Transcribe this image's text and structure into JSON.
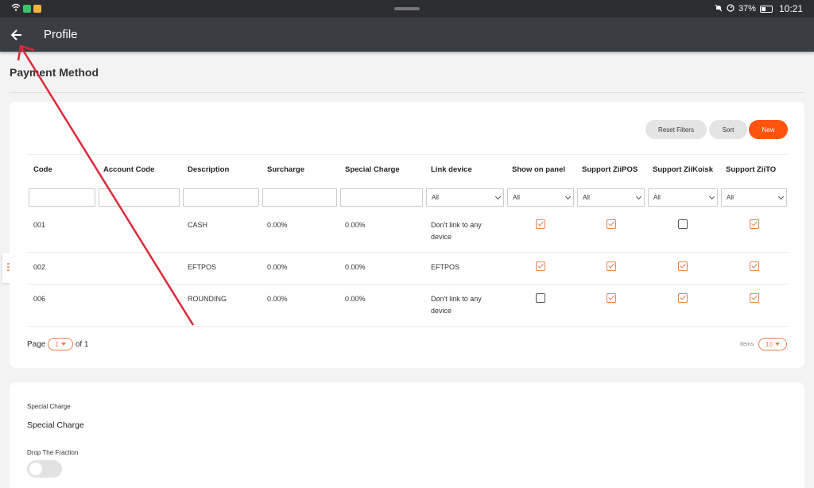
{
  "status_bar": {
    "battery": "37%",
    "time": "10:21"
  },
  "appbar": {
    "title": "Profile"
  },
  "page": {
    "title": "Payment Method"
  },
  "toolbar": {
    "reset_filters": "Reset Filters",
    "sort": "Sort",
    "new": "New"
  },
  "table": {
    "headers": [
      "Code",
      "Account Code",
      "Description",
      "Surcharge",
      "Special Charge",
      "Link device",
      "Show on panel",
      "Support ZiiPOS",
      "Support ZiiKoisk",
      "Support ZiiTO"
    ],
    "filter_select_value": "All",
    "rows": [
      {
        "code": "001",
        "account_code": "",
        "description": "CASH",
        "surcharge": "0.00%",
        "special_charge": "0.00%",
        "link_device": "Don't link to any device",
        "show_on_panel": true,
        "support_ziipos": true,
        "support_ziikoisk": false,
        "support_ziito": true
      },
      {
        "code": "002",
        "account_code": "",
        "description": "EFTPOS",
        "surcharge": "0.00%",
        "special_charge": "0.00%",
        "link_device": "EFTPOS",
        "show_on_panel": true,
        "support_ziipos": true,
        "support_ziikoisk": true,
        "support_ziito": true
      },
      {
        "code": "006",
        "account_code": "",
        "description": "ROUNDING",
        "surcharge": "0.00%",
        "special_charge": "0.00%",
        "link_device": "Don't link to any device",
        "show_on_panel": false,
        "support_ziipos": true,
        "support_ziikoisk": true,
        "support_ziito": true
      }
    ]
  },
  "pagination": {
    "page_label": "Page",
    "page_value": "1",
    "of_label": "of 1",
    "items_label": "Items",
    "items_value": "10"
  },
  "details": {
    "special_charge_label": "Special Charge",
    "special_charge_value": "Special Charge",
    "drop_fraction_label": "Drop The Fraction",
    "drop_fraction_on": false
  },
  "colors": {
    "accent": "#ff5410",
    "checkbox": "#e8824a",
    "appbar": "#3b3d45",
    "annotation_arrow": "#d92b3a"
  }
}
